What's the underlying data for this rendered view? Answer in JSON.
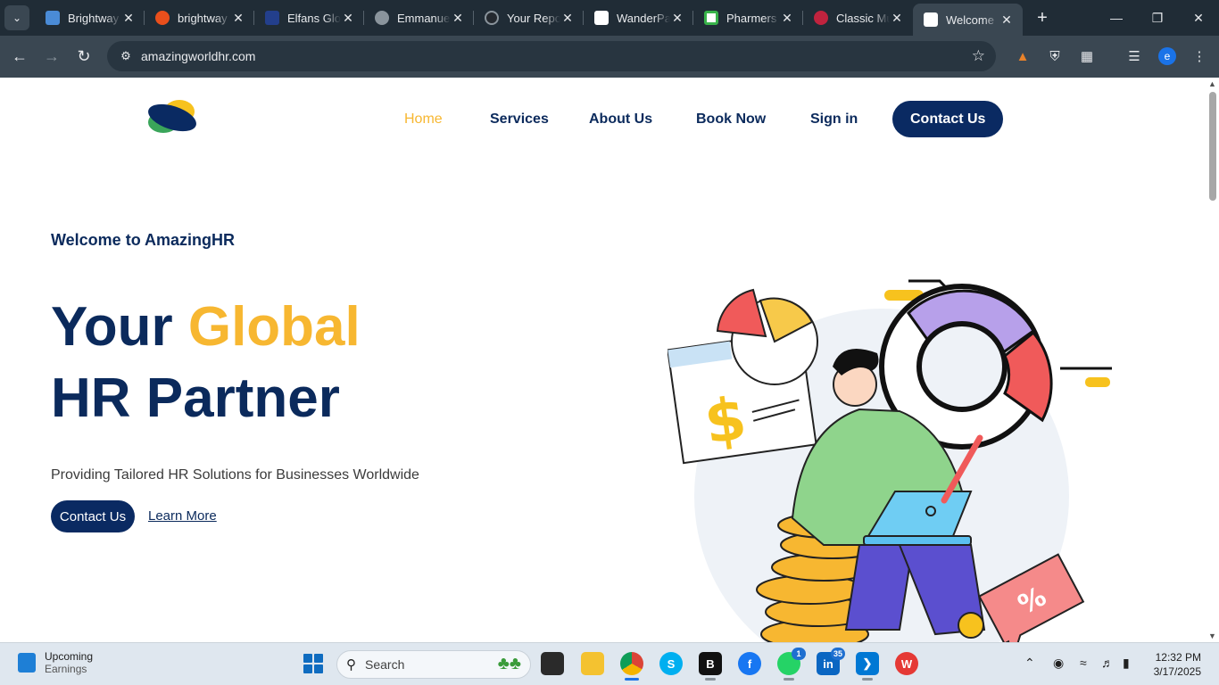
{
  "browser": {
    "tabs": [
      {
        "title": "Brightway",
        "color": "#4a8bd6"
      },
      {
        "title": "brightway",
        "color": "#e94f1c"
      },
      {
        "title": "Elfans Glo",
        "color": "#233f8c"
      },
      {
        "title": "Emmanue",
        "color": "#8a949c"
      },
      {
        "title": "Your Repo",
        "color": "#24292f"
      },
      {
        "title": "WanderPa",
        "color": "#ffffff"
      },
      {
        "title": "Pharmers",
        "color": "#38b24a"
      },
      {
        "title": "Classic Mu",
        "color": "#c0233e"
      },
      {
        "title": "Welcome",
        "color": "#ffffff",
        "active": true
      }
    ],
    "url": "amazingworldhr.com",
    "avatar": "e"
  },
  "site": {
    "nav": {
      "home": "Home",
      "services": "Services",
      "about": "About Us",
      "book": "Book Now",
      "signin": "Sign in",
      "contact": "Contact Us"
    },
    "hero": {
      "welcome": "Welcome to AmazingHR",
      "line1_a": "Your",
      "line1_b": "Global",
      "line2": "HR Partner",
      "subtitle": "Providing Tailored HR Solutions for Businesses Worldwide",
      "cta_primary": "Contact Us",
      "cta_link": "Learn More"
    },
    "colors": {
      "navy": "#0a2a62",
      "gold": "#f7b731"
    }
  },
  "taskbar": {
    "widget_title": "Upcoming",
    "widget_sub": "Earnings",
    "search_placeholder": "Search",
    "whatsapp_badge": "1",
    "linkedin_badge": "35",
    "time": "12:32 PM",
    "date": "3/17/2025"
  }
}
